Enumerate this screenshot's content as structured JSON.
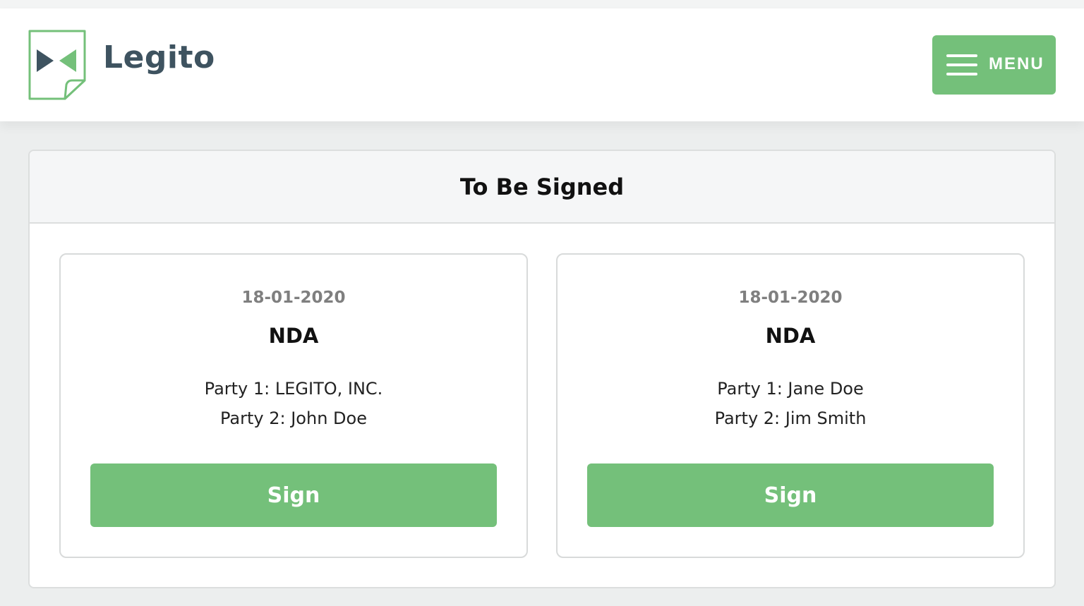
{
  "header": {
    "brand": "Legito",
    "menu_label": "MENU",
    "accent_color": "#74c07a",
    "brand_color": "#3e5360"
  },
  "panel": {
    "title": "To Be Signed"
  },
  "cards": [
    {
      "date": "18-01-2020",
      "type": "NDA",
      "party1": "Party 1: LEGITO, INC.",
      "party2": "Party 2: John Doe",
      "button_label": "Sign"
    },
    {
      "date": "18-01-2020",
      "type": "NDA",
      "party1": "Party 1: Jane Doe",
      "party2": "Party 2: Jim Smith",
      "button_label": "Sign"
    }
  ],
  "icons": {
    "logo": "legito-logo-icon",
    "menu": "hamburger-icon"
  }
}
